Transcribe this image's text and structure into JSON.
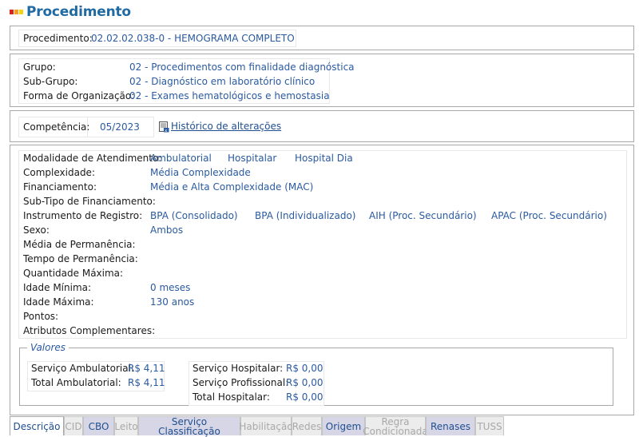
{
  "page": {
    "title": "Procedimento"
  },
  "procedimento": {
    "label": "Procedimento:",
    "value": "02.02.02.038-0 - HEMOGRAMA COMPLETO"
  },
  "classificacao": {
    "grupo_label": "Grupo:",
    "grupo_value": "02 - Procedimentos com finalidade diagnóstica",
    "subgrupo_label": "Sub-Grupo:",
    "subgrupo_value": "02 - Diagnóstico em laboratório clínico",
    "forma_label": "Forma de Organização:",
    "forma_value": "02 - Exames hematológicos e hemostasia"
  },
  "competencia": {
    "label": "Competência:",
    "value": "05/2023",
    "history_link": "Histórico de alterações",
    "history_icon": "document-history-icon"
  },
  "atributos": {
    "modalidade_label": "Modalidade de Atendimento:",
    "modalidade": [
      "Ambulatorial",
      "Hospitalar",
      "Hospital Dia"
    ],
    "complexidade_label": "Complexidade:",
    "complexidade": "Média Complexidade",
    "financiamento_label": "Financiamento:",
    "financiamento": "Média e Alta Complexidade (MAC)",
    "subtipo_label": "Sub-Tipo de Financiamento:",
    "instrumento_label": "Instrumento de Registro:",
    "instrumento": [
      "BPA (Consolidado)",
      "BPA (Individualizado)",
      "AIH (Proc. Secundário)",
      "APAC (Proc. Secundário)"
    ],
    "sexo_label": "Sexo:",
    "sexo": "Ambos",
    "media_perm_label": "Média de Permanência:",
    "tempo_perm_label": "Tempo de Permanência:",
    "qtd_max_label": "Quantidade Máxima:",
    "idade_min_label": "Idade Mínima:",
    "idade_min": "0 meses",
    "idade_max_label": "Idade Máxima:",
    "idade_max": "130 anos",
    "pontos_label": "Pontos:",
    "atributos_comp_label": "Atributos Complementares:"
  },
  "valores": {
    "legend": "Valores",
    "serv_amb_label": "Serviço Ambulatorial:",
    "serv_amb": "R$ 4,11",
    "total_amb_label": "Total Ambulatorial:",
    "total_amb": "R$ 4,11",
    "serv_hosp_label": "Serviço Hospitalar:",
    "serv_hosp": "R$ 0,00",
    "serv_prof_label": "Serviço Profissional:",
    "serv_prof": "R$ 0,00",
    "total_hosp_label": "Total Hospitalar:",
    "total_hosp": "R$ 0,00"
  },
  "tabs": [
    {
      "label": "Descrição",
      "state": "active"
    },
    {
      "label": "CID",
      "state": "disabled"
    },
    {
      "label": "CBO",
      "state": "enabled"
    },
    {
      "label": "Leito",
      "state": "disabled"
    },
    {
      "label": "Serviço Classificação",
      "state": "enabled"
    },
    {
      "label": "Habilitação",
      "state": "disabled"
    },
    {
      "label": "Redes",
      "state": "disabled"
    },
    {
      "label": "Origem",
      "state": "enabled"
    },
    {
      "label": "Regra Condicionada",
      "state": "disabled"
    },
    {
      "label": "Renases",
      "state": "enabled"
    },
    {
      "label": "TUSS",
      "state": "disabled"
    }
  ],
  "colors": {
    "title": "#1f6aa3",
    "value": "#2a5aa0",
    "icon_red": "#d9261c",
    "icon_orange": "#f2a11f",
    "icon_yellow": "#f6d21b"
  }
}
